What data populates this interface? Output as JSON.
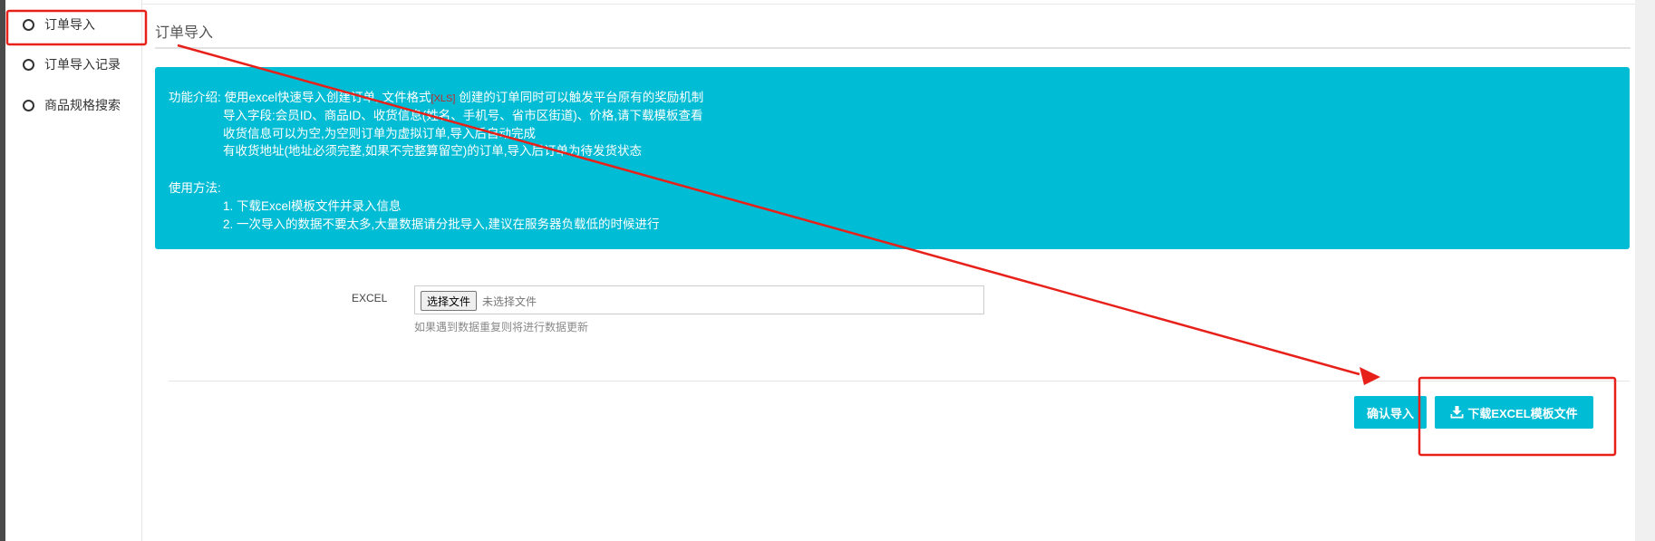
{
  "sidebar": {
    "items": [
      {
        "label": "订单导入"
      },
      {
        "label": "订单导入记录"
      },
      {
        "label": "商品规格搜索"
      }
    ]
  },
  "page": {
    "title": "订单导入"
  },
  "info": {
    "line1_prefix": "功能介绍: 使用excel快速导入创建订单, 文件格式",
    "line1_format": "[XLS]",
    "line1_suffix": " 创建的订单同时可以触发平台原有的奖励机制",
    "line2": "导入字段:会员ID、商品ID、收货信息(姓名、手机号、省市区街道)、价格,请下载模板查看",
    "line3": "收货信息可以为空,为空则订单为虚拟订单,导入后自动完成",
    "line4": "有收货地址(地址必须完整,如果不完整算留空)的订单,导入后订单为待发货状态",
    "usage_title": "使用方法:",
    "usage1": "1. 下载Excel模板文件并录入信息",
    "usage2": "2. 一次导入的数据不要太多,大量数据请分批导入,建议在服务器负载低的时候进行"
  },
  "form": {
    "label": "EXCEL",
    "file_button": "选择文件",
    "file_status": "未选择文件",
    "help": "如果遇到数据重复则将进行数据更新"
  },
  "buttons": {
    "confirm": "确认导入",
    "download": "下载EXCEL模板文件"
  },
  "colors": {
    "accent": "#00bcd4",
    "annotation": "#e8201a"
  }
}
